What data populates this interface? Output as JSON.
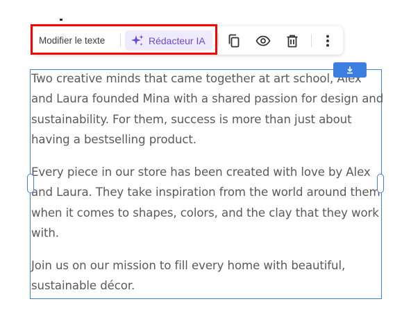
{
  "toolbar": {
    "edit_text_label": "Modifier le texte",
    "ai_writer_label": "Rédacteur IA",
    "icons": [
      "sparkle-icon",
      "copy-icon",
      "eye-icon",
      "trash-icon",
      "more-vertical-icon"
    ]
  },
  "text_block": {
    "paragraphs": [
      "Two creative minds that came together at art school, Alex and Laura founded Mina with a shared passion for design and sustainability. For them, success is more than just about having a bestselling product.",
      "Every piece in our store has been created with love by Alex and Laura. They take inspiration from the world around them when it comes to shapes, colors, and the clay that they work with.",
      "Join us on our mission to fill every home with beautiful, sustainable décor."
    ]
  },
  "colors": {
    "selection_blue": "#3d7fe0",
    "ai_purple": "#6b47d6",
    "ai_background": "#efeafc",
    "highlight_red": "#ff0000",
    "body_text": "#5a5a5a"
  }
}
